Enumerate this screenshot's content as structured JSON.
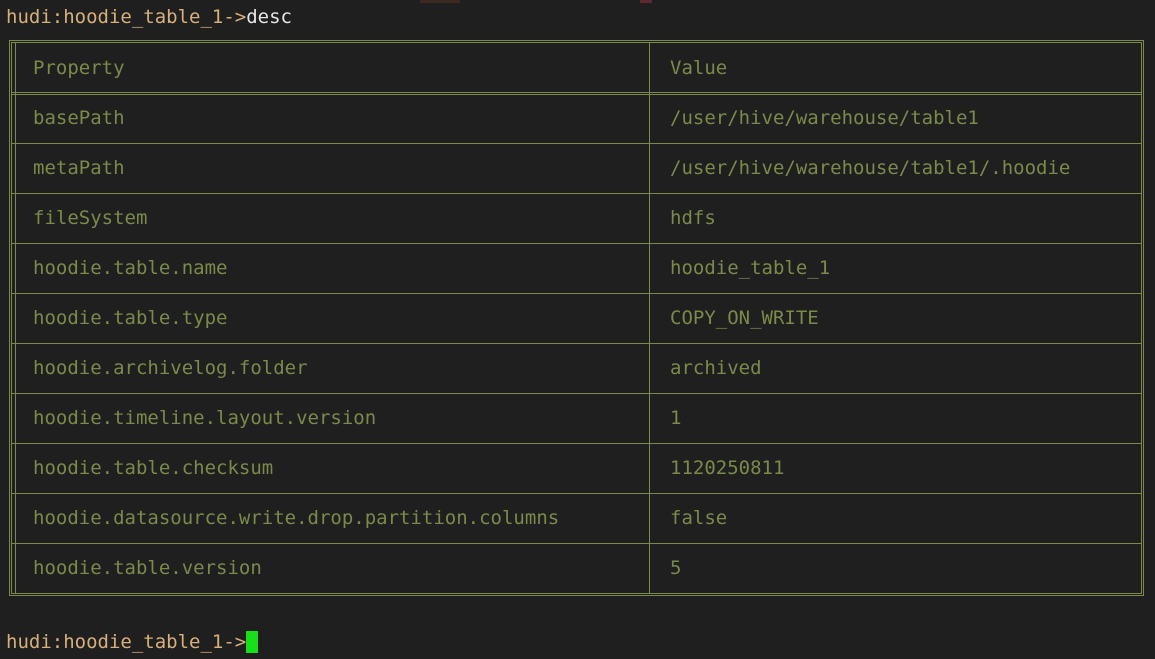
{
  "terminal": {
    "prompt": "hudi:hoodie_table_1->",
    "command": "desc"
  },
  "table": {
    "headers": [
      "Property",
      "Value"
    ],
    "rows": [
      [
        "basePath",
        "/user/hive/warehouse/table1"
      ],
      [
        "metaPath",
        "/user/hive/warehouse/table1/.hoodie"
      ],
      [
        "fileSystem",
        "hdfs"
      ],
      [
        "hoodie.table.name",
        "hoodie_table_1"
      ],
      [
        "hoodie.table.type",
        "COPY_ON_WRITE"
      ],
      [
        "hoodie.archivelog.folder",
        "archived"
      ],
      [
        "hoodie.timeline.layout.version",
        "1"
      ],
      [
        "hoodie.table.checksum",
        "1120250811"
      ],
      [
        "hoodie.datasource.write.drop.partition.columns",
        "false"
      ],
      [
        "hoodie.table.version",
        "5"
      ]
    ]
  },
  "colors": {
    "background": "#1f1f1f",
    "table_text": "#7a8a4a",
    "prompt": "#d6b07a",
    "command": "#e6e6e6",
    "cursor": "#18e018"
  }
}
